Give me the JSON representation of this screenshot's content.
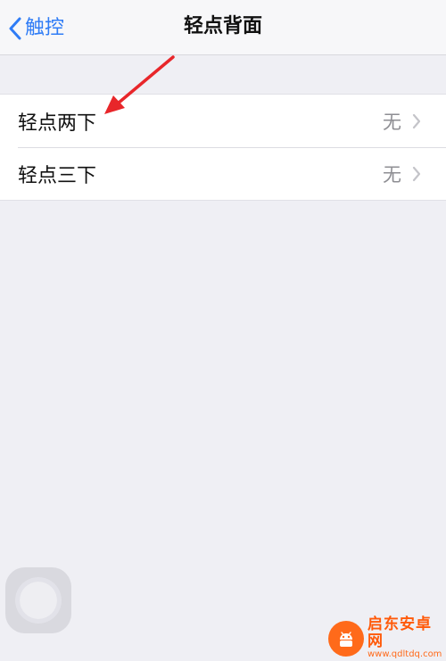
{
  "nav": {
    "back_label": "触控",
    "title": "轻点背面"
  },
  "settings": {
    "rows": [
      {
        "label": "轻点两下",
        "value": "无"
      },
      {
        "label": "轻点三下",
        "value": "无"
      }
    ]
  },
  "watermark": {
    "name": "启东安卓网",
    "url": "www.qdltdq.com"
  },
  "colors": {
    "accent": "#2f7cf6",
    "annotation_arrow": "#e8262a",
    "background": "#efeff4",
    "secondary_text": "#8e8e93",
    "watermark": "#ff5a0a"
  },
  "icons": {
    "back": "chevron-left-icon",
    "row_disclosure": "chevron-right-icon",
    "annotation": "red-arrow-icon",
    "assistive_touch": "assistive-touch-icon",
    "watermark_logo": "android-logo-icon"
  }
}
